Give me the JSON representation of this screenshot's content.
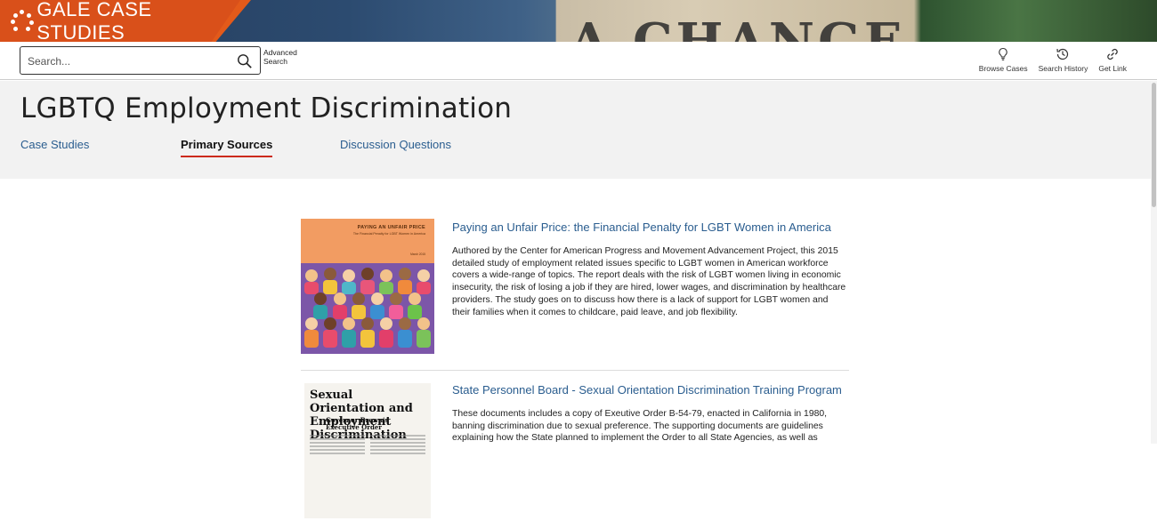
{
  "brand": {
    "title": "GALE CASE STUDIES",
    "banner_text": "A CHANGE"
  },
  "search": {
    "placeholder": "Search...",
    "advanced_label_line1": "Advanced",
    "advanced_label_line2": "Search"
  },
  "tools": [
    {
      "label": "Browse Cases",
      "icon": "lightbulb-icon"
    },
    {
      "label": "Search History",
      "icon": "history-icon"
    },
    {
      "label": "Get Link",
      "icon": "link-icon"
    }
  ],
  "page": {
    "title": "LGBTQ Employment Discrimination",
    "tabs": [
      {
        "label": "Case Studies",
        "active": false
      },
      {
        "label": "Primary Sources",
        "active": true
      },
      {
        "label": "Discussion Questions",
        "active": false
      }
    ]
  },
  "results": [
    {
      "title": "Paying an Unfair Price: the Financial Penalty for LGBT Women in America",
      "description": "Authored by the Center for American Progress and Movement Advancement Project, this 2015 detailed study of employment related issues specific to LGBT women in American workforce covers a wide-range of topics. The report deals with the risk of LGBT women living in economic insecurity, the risk of losing a job if they are hired, lower wages, and discrimination by healthcare providers. The study goes on to discuss how there is a lack of support for LGBT women and their families when it comes to childcare, paid leave, and job flexibility.",
      "cover": {
        "heading": "PAYING AN UNFAIR PRICE",
        "subheading": "The Financial Penalty for LGBT Women in America",
        "date": "March 2015"
      }
    },
    {
      "title": "State Personnel Board - Sexual Orientation Discrimination Training Program",
      "description": "These documents includes a copy of Exeutive Order B-54-79, enacted in California in 1980, banning discrimination due to sexual preference. The supporting documents are guidelines explaining how the State planned to implement the Order to all State Agencies, as well as",
      "cover": {
        "heading_line1": "Sexual Orientation and",
        "heading_line2": "Employment Discrimination",
        "sub_line1": "Governor Brown's",
        "sub_line2": "Executive Order"
      }
    }
  ],
  "colors": {
    "brand_orange": "#d9501a",
    "link_blue": "#2a5d8f",
    "active_underline": "#cc2a1a"
  }
}
